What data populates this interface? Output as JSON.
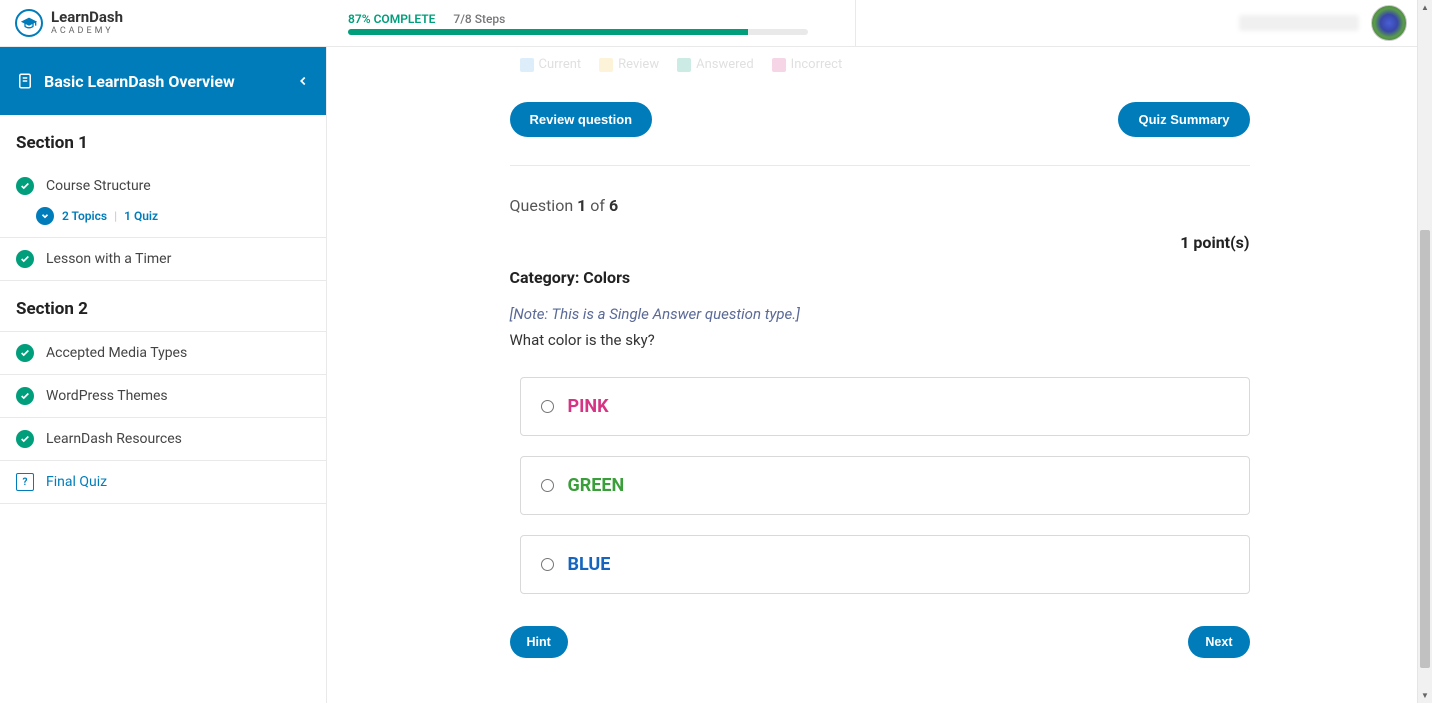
{
  "brand": {
    "name": "LearnDash",
    "sub": "ACADEMY"
  },
  "header": {
    "completion": "87% COMPLETE",
    "steps": "7/8 Steps",
    "progress_pct": 87
  },
  "sidebar": {
    "title": "Basic LearnDash Overview",
    "section1_heading": "Section 1",
    "section2_heading": "Section 2",
    "items": {
      "course_structure": "Course Structure",
      "lesson_timer": "Lesson with a Timer",
      "accepted_media": "Accepted Media Types",
      "wp_themes": "WordPress Themes",
      "ld_resources": "LearnDash Resources",
      "final_quiz": "Final Quiz"
    },
    "expand": {
      "topics": "2 Topics",
      "quiz": "1 Quiz"
    }
  },
  "quiz": {
    "review_question_btn": "Review question",
    "quiz_summary_btn": "Quiz Summary",
    "question_word": "Question ",
    "question_num": "1",
    "of_word": " of ",
    "question_total": "6",
    "points": "1 point(s)",
    "category": "Category: Colors",
    "note": "[Note: This is a Single Answer question type.]",
    "question_text": "What color is the sky?",
    "answers": {
      "pink": "PINK",
      "green": "GREEN",
      "blue": "BLUE"
    },
    "hint_btn": "Hint",
    "next_btn": "Next"
  },
  "colors": {
    "primary": "#007cba",
    "success": "#019e7c"
  }
}
